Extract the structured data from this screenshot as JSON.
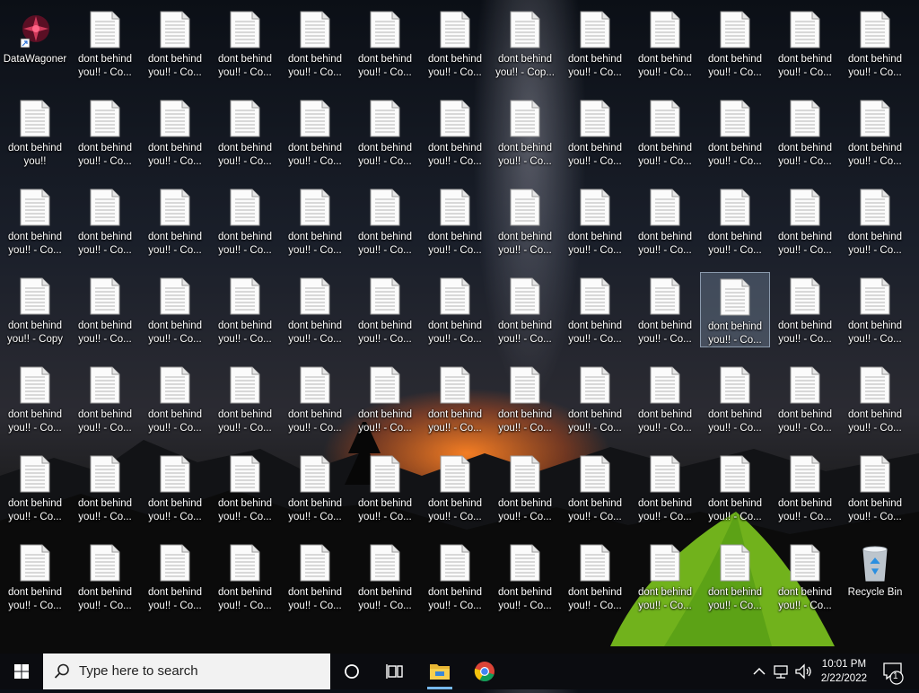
{
  "desktop": {
    "shortcut": {
      "label": "DataWagoner"
    },
    "file_label_line1": "dont behind",
    "file_label_line2_default": "you!! - Co...",
    "file_label_first_row4": "you!! - Copy",
    "file_label_row1_col8": "you!! - Cop...",
    "file_label_plain": "you!!",
    "recycle_bin": {
      "label": "Recycle Bin"
    }
  },
  "taskbar": {
    "search_placeholder": "Type here to search",
    "time": "10:01 PM",
    "date": "2/22/2022",
    "notification_count": "1"
  },
  "colors": {
    "taskbar_bg": "#0b0c10",
    "search_bg": "#f2f2f2",
    "chrome_red": "#db4437"
  },
  "icons": [
    "windows-logo-icon",
    "search-icon",
    "cortana-icon",
    "task-view-icon",
    "file-explorer-icon",
    "chrome-icon",
    "chevron-up-icon",
    "network-icon",
    "volume-icon",
    "notification-icon",
    "document-icon",
    "recycle-bin-icon",
    "shortcut-icon"
  ]
}
